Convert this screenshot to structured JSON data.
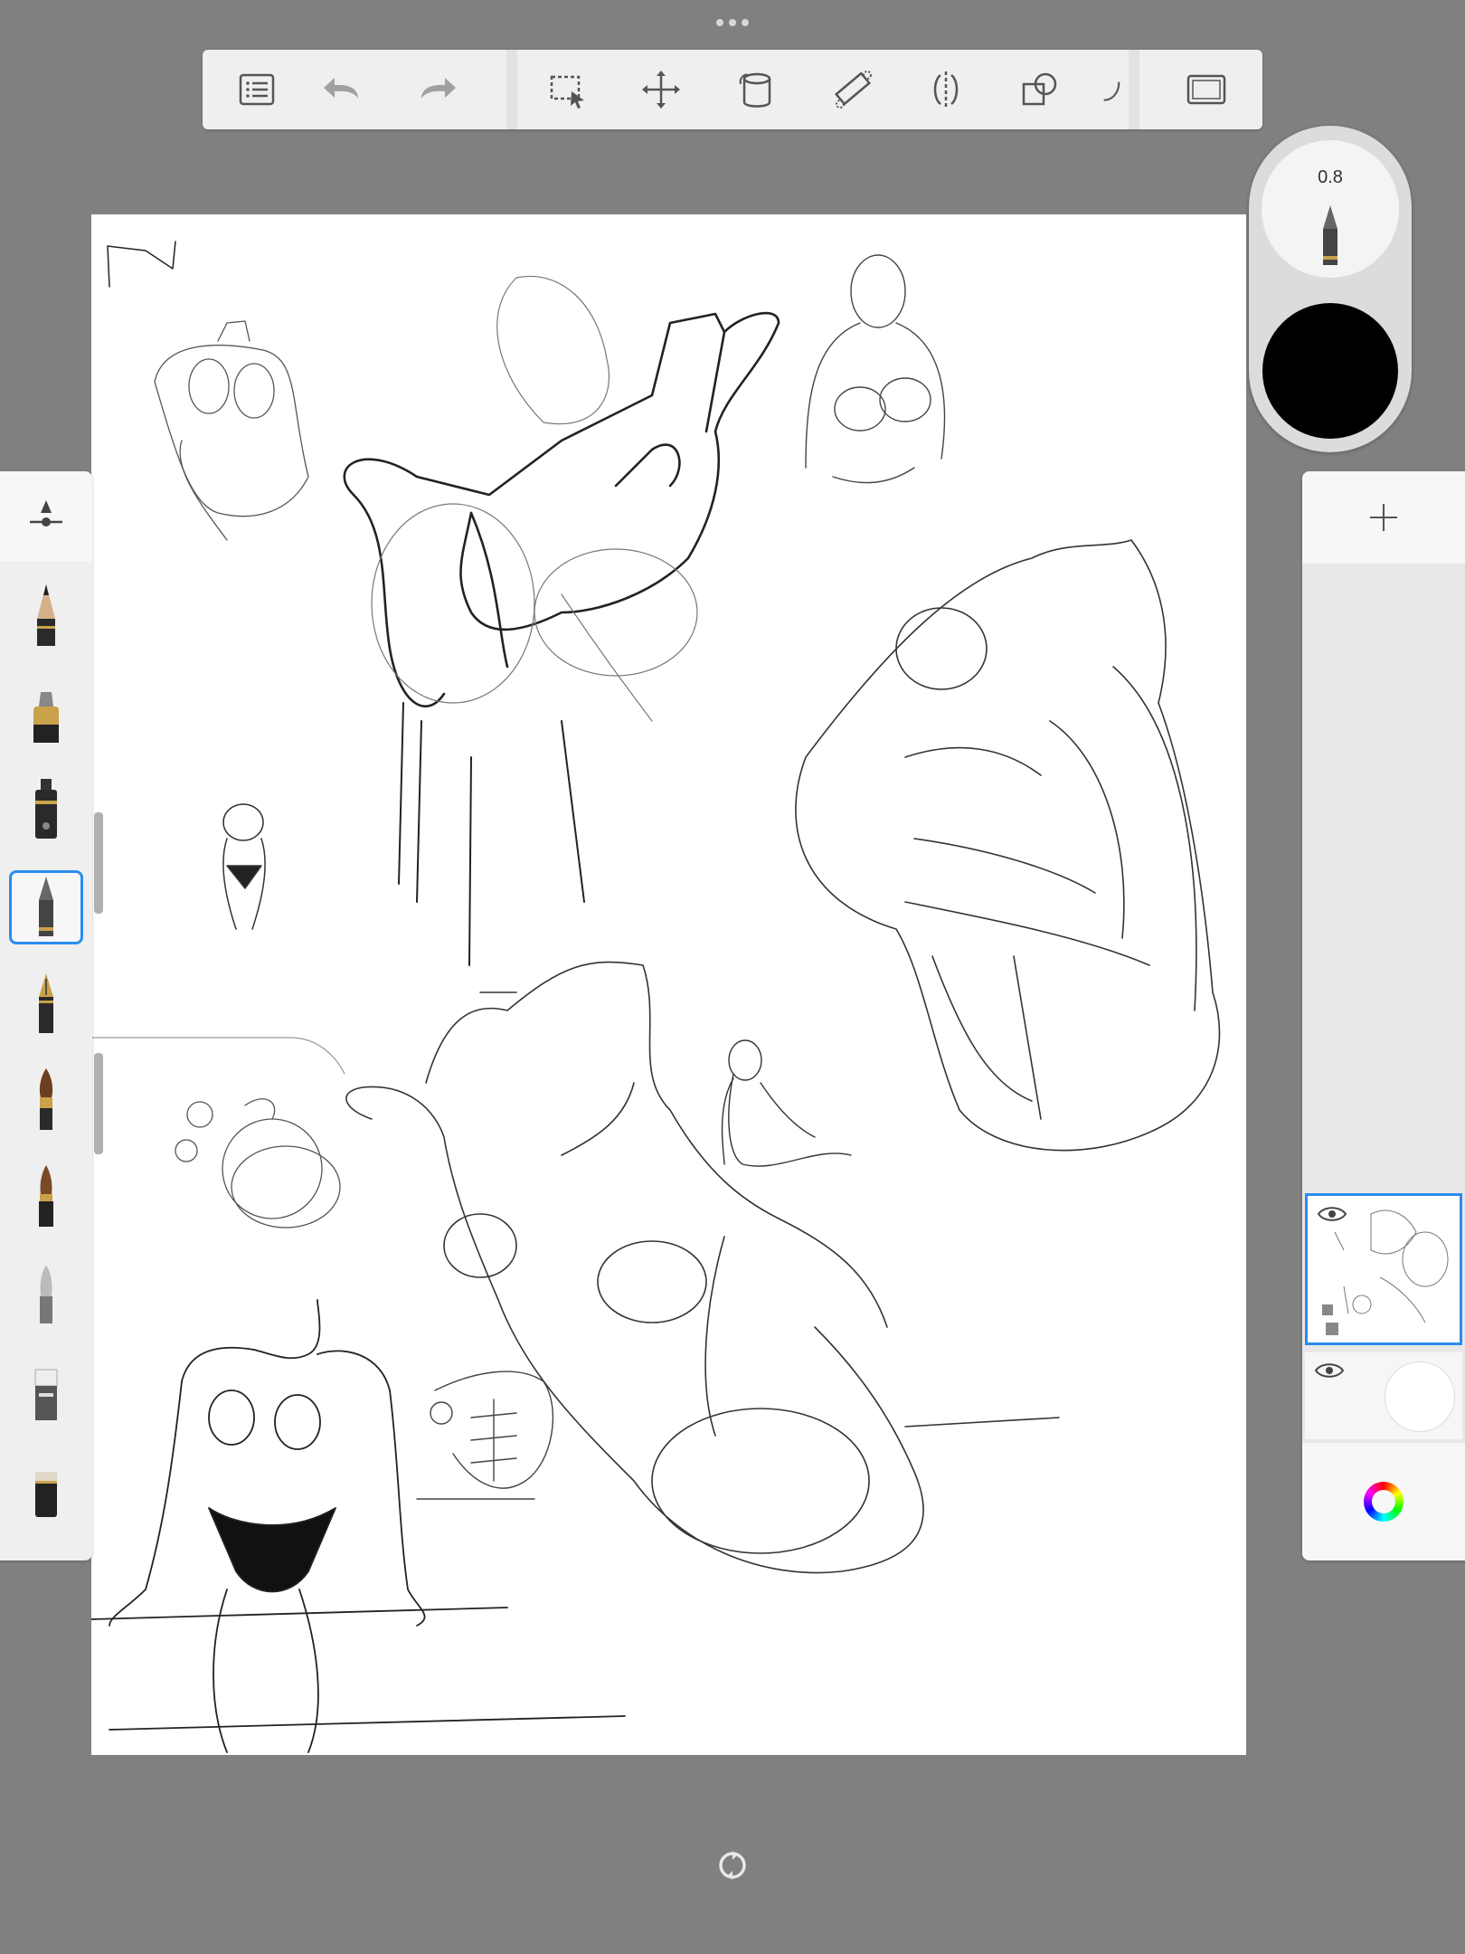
{
  "toolbar": {
    "buttons": [
      {
        "name": "list-icon"
      },
      {
        "name": "undo-icon"
      },
      {
        "name": "redo-icon"
      },
      {
        "name": "selection-icon"
      },
      {
        "name": "transform-icon"
      },
      {
        "name": "fill-bucket-icon"
      },
      {
        "name": "ruler-icon"
      },
      {
        "name": "symmetry-icon"
      },
      {
        "name": "shapes-icon"
      },
      {
        "name": "more-icon"
      },
      {
        "name": "fullscreen-icon"
      }
    ]
  },
  "brush_palette": {
    "items": [
      {
        "name": "pencil-brush"
      },
      {
        "name": "marker-brush"
      },
      {
        "name": "airbrush-brush"
      },
      {
        "name": "ballpoint-brush",
        "selected": true
      },
      {
        "name": "fountain-pen-brush"
      },
      {
        "name": "paintbrush-brush"
      },
      {
        "name": "ink-brush"
      },
      {
        "name": "smudge-brush"
      },
      {
        "name": "eraser-brush"
      },
      {
        "name": "hard-eraser-brush"
      }
    ]
  },
  "brush_puck": {
    "size_value": "0.8",
    "color": "#000000"
  },
  "layers": {
    "items": [
      {
        "name": "layer-1",
        "visible": true,
        "active": true
      },
      {
        "name": "background-layer",
        "visible": true,
        "active": false
      }
    ]
  },
  "colors": {
    "accent": "#2b8cf0",
    "background": "#808080",
    "canvas": "#ffffff"
  }
}
